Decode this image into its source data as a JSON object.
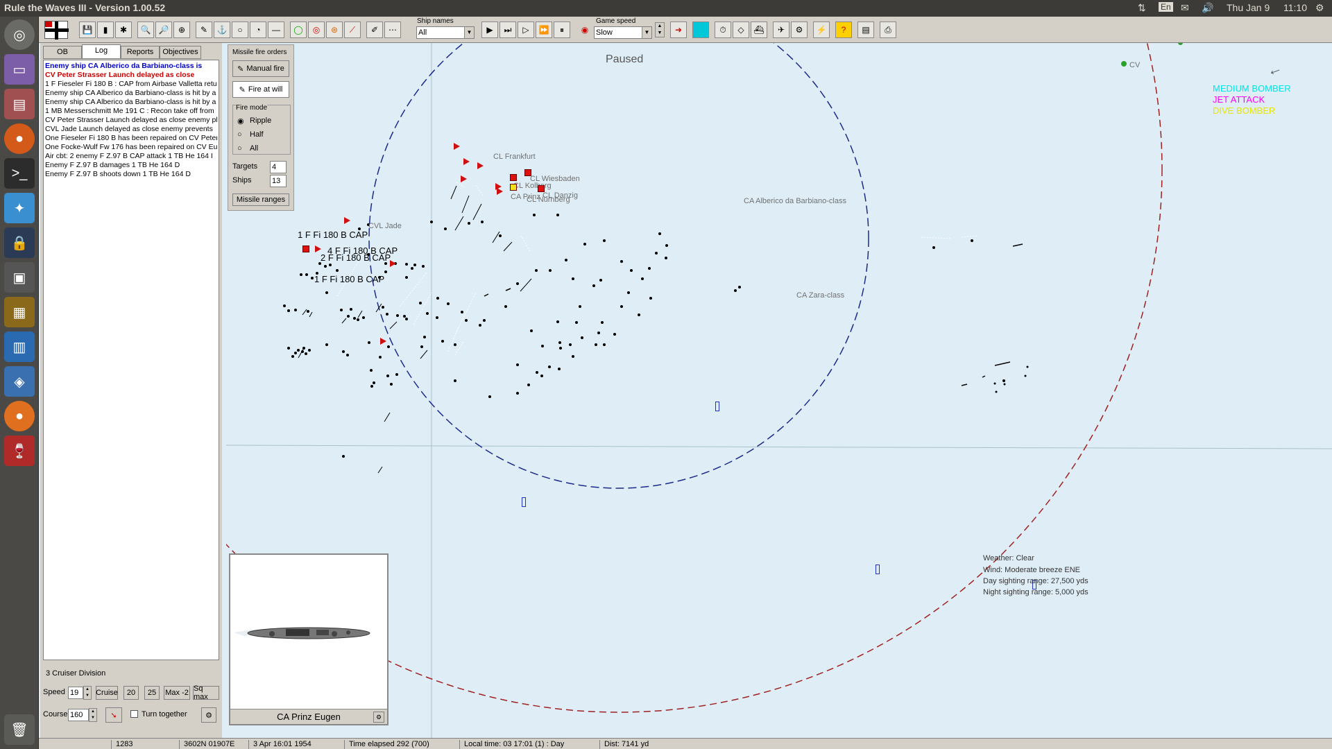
{
  "window": {
    "title": "Rule the Waves III - Version 1.00.52"
  },
  "tray": {
    "lang": "En",
    "date": "Thu Jan 9",
    "time": "11:10"
  },
  "toolbar": {
    "ship_names_label": "Ship names",
    "ship_names_value": "All",
    "game_speed_label": "Game speed",
    "game_speed_value": "Slow"
  },
  "tabs": [
    "OB",
    "Log",
    "Reports",
    "Objectives"
  ],
  "log": [
    {
      "text": "Enemy ship CA Alberico da Barbiano-class is",
      "color": "#0000cc",
      "bold": true
    },
    {
      "text": "CV Peter Strasser Launch delayed as close",
      "color": "#cc0000",
      "bold": true
    },
    {
      "text": "1 F Fieseler Fi 180 B : CAP from Airbase Valletta retur",
      "color": "#000",
      "bold": false
    },
    {
      "text": "Enemy ship CA Alberico da Barbiano-class is hit by a",
      "color": "#000",
      "bold": false
    },
    {
      "text": "Enemy ship CA Alberico da Barbiano-class is hit by a",
      "color": "#000",
      "bold": false
    },
    {
      "text": "1 MB Messerschmitt Me 191 C : Recon take off from",
      "color": "#000",
      "bold": false
    },
    {
      "text": "CV Peter Strasser Launch delayed as close enemy pl",
      "color": "#000",
      "bold": false
    },
    {
      "text": "CVL Jade Launch delayed as close enemy prevents",
      "color": "#000",
      "bold": false
    },
    {
      "text": "One Fieseler Fi 180 B has been repaired on CV Peter",
      "color": "#000",
      "bold": false
    },
    {
      "text": "One Focke-Wulf Fw 176 has been repaired on CV Eu",
      "color": "#000",
      "bold": false
    },
    {
      "text": "Air cbt: 2  enemy F Z.97 B CAP attack 1 TB He 164 I",
      "color": "#000",
      "bold": false
    },
    {
      "text": " Enemy F Z.97 B damages 1 TB He 164 D",
      "color": "#000",
      "bold": false
    },
    {
      "text": " Enemy F Z.97 B shoots down 1 TB He 164 D",
      "color": "#000",
      "bold": false
    }
  ],
  "division": {
    "name": "3 Cruiser Division",
    "speed_label": "Speed",
    "speed_value": "19",
    "cruise": "Cruise",
    "s20": "20",
    "s25": "25",
    "max": "Max -2",
    "sqmax": "Sq max",
    "course_label": "Course",
    "course_value": "160",
    "turn_together": "Turn together"
  },
  "missile": {
    "title": "Missile fire orders",
    "manual": "Manual fire",
    "atwill": "Fire at will",
    "mode_label": "Fire mode",
    "ripple": "Ripple",
    "half": "Half",
    "all": "All",
    "targets_label": "Targets",
    "targets_value": "4",
    "ships_label": "Ships",
    "ships_value": "13",
    "ranges": "Missile ranges"
  },
  "ship_preview": {
    "name": "CA Prinz Eugen"
  },
  "map": {
    "paused": "Paused",
    "legend": [
      {
        "text": "MEDIUM BOMBER",
        "color": "#00e5e5"
      },
      {
        "text": "JET ATTACK",
        "color": "#ff00ff"
      },
      {
        "text": "DIVE BOMBER",
        "color": "#e5e500"
      }
    ],
    "labels": {
      "frankfurt": "CL Frankfurt",
      "wiesbaden": "CL Wiesbaden",
      "kolberg": "CL Kolberg",
      "danzig": "CL Danzig",
      "nurnberg": "CL Nürnberg",
      "prinz": "CA Prinz",
      "jade": "CVL Jade",
      "alberico": "CA Alberico da Barbiano-class",
      "zara": "CA Zara-class",
      "cv": "CV"
    },
    "air": {
      "cap1": "1 F Fi 180 B CAP",
      "cap4": "4 F Fi 180 B CAP",
      "cap2": "2 F Fi 180 B CAP",
      "cap1b": "1 F Fi 180 B CAP"
    },
    "weather": {
      "weather": "Weather: Clear",
      "wind": "Wind: Moderate breeze  ENE",
      "day": "Day sighting range: 27,500 yds",
      "night": "Night sighting range: 5,000 yds"
    }
  },
  "status": {
    "a": "1283",
    "b": "3602N 01907E",
    "c": "3 Apr 16:01 1954",
    "d": "Time elapsed 292 (700)",
    "e": "Local time: 03 17:01 (1) : Day",
    "f": "Dist: 7141 yd"
  }
}
